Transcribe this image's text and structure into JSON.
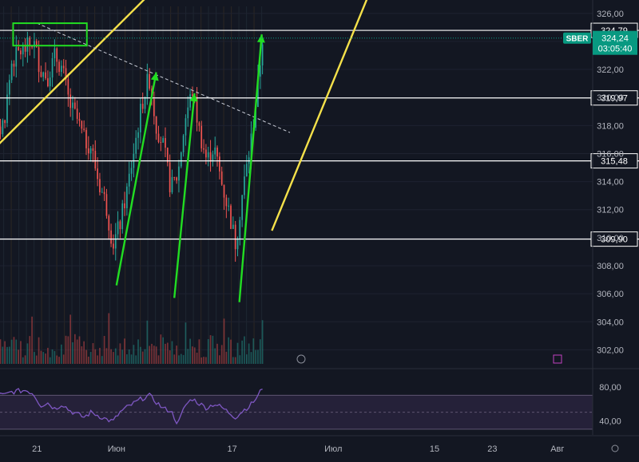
{
  "chart_data": [
    {
      "type": "candlestick",
      "symbol": "SBER",
      "y_axis": {
        "min": 301.0,
        "max": 326.5,
        "ticks": [
          "326,00",
          "324,00",
          "322,00",
          "320,00",
          "318,00",
          "316,00",
          "314,00",
          "312,00",
          "310,00",
          "308,00",
          "306,00",
          "304,00",
          "302,00"
        ],
        "tick_values": [
          326,
          324,
          322,
          320,
          318,
          316,
          314,
          312,
          310,
          308,
          306,
          304,
          302
        ]
      },
      "x_axis": {
        "ticks": [
          {
            "label": "21",
            "x": 21
          },
          {
            "label": "Июн",
            "x": 32
          },
          {
            "label": "17",
            "x": 48
          },
          {
            "label": "Июл",
            "x": 62
          },
          {
            "label": "15",
            "x": 76
          },
          {
            "label": "23",
            "x": 84
          },
          {
            "label": "Авг",
            "x": 93
          }
        ],
        "range": [
          15,
          97
        ]
      },
      "price_label": {
        "symbol": "SBER",
        "price": "324,24",
        "timer": "03:05:40",
        "value": 324.24
      },
      "horizontal_levels": [
        {
          "label": "324,79",
          "value": 324.79
        },
        {
          "label": "319,97",
          "value": 319.97
        },
        {
          "label": "315,48",
          "value": 315.48
        },
        {
          "label": "309,90",
          "value": 309.9
        }
      ],
      "trend_lines": [
        {
          "name": "yellow-line-1",
          "color": "#f5e14a",
          "dashed": false,
          "x": [
            15.0,
            41.5
          ],
          "y": [
            316.3,
            329.9
          ]
        },
        {
          "name": "yellow-line-2",
          "color": "#f5e14a",
          "dashed": false,
          "x": [
            53.5,
            69.5
          ],
          "y": [
            310.5,
            330.6
          ]
        },
        {
          "name": "dashed-resistance",
          "color": "#c8ccd6",
          "dashed": true,
          "x": [
            21.0,
            56.0
          ],
          "y": [
            325.3,
            317.5
          ]
        }
      ],
      "arrows": [
        {
          "name": "green-arrow-1",
          "color": "#22dd22",
          "x": [
            32.0,
            37.5
          ],
          "y": [
            306.6,
            321.8
          ]
        },
        {
          "name": "green-arrow-2",
          "color": "#22dd22",
          "x": [
            40.0,
            42.8
          ],
          "y": [
            305.7,
            320.3
          ]
        },
        {
          "name": "green-arrow-3",
          "color": "#22dd22",
          "x": [
            49.0,
            52.1
          ],
          "y": [
            305.4,
            324.5
          ]
        }
      ],
      "highlight_box": {
        "name": "top-highlight-box",
        "color": "#22dd22",
        "x": [
          17.7,
          27.9
        ],
        "y": [
          325.3,
          323.7
        ]
      },
      "candle_seed": {
        "x_start": 15.0,
        "x_end": 52.2,
        "count": 120
      },
      "candles_ohlc_path": [
        {
          "x": 15.0,
          "o": 315.0,
          "c": 316.5
        },
        {
          "x": 16.5,
          "o": 317.5,
          "c": 318.5
        },
        {
          "x": 17.5,
          "o": 319.5,
          "c": 322.5
        },
        {
          "x": 18.5,
          "o": 322.0,
          "c": 323.2
        },
        {
          "x": 19.5,
          "o": 323.0,
          "c": 323.5
        },
        {
          "x": 20.5,
          "o": 322.0,
          "c": 324.0
        },
        {
          "x": 21.5,
          "o": 321.5,
          "c": 322.0
        },
        {
          "x": 22.5,
          "o": 322.5,
          "c": 321.5
        },
        {
          "x": 23.5,
          "o": 322.0,
          "c": 323.0
        },
        {
          "x": 24.5,
          "o": 323.5,
          "c": 322.0
        },
        {
          "x": 25.5,
          "o": 321.5,
          "c": 319.5
        },
        {
          "x": 26.5,
          "o": 320.5,
          "c": 318.5
        },
        {
          "x": 27.5,
          "o": 318.0,
          "c": 317.0
        },
        {
          "x": 28.5,
          "o": 317.5,
          "c": 316.5
        },
        {
          "x": 29.5,
          "o": 316.5,
          "c": 314.0
        },
        {
          "x": 30.5,
          "o": 313.5,
          "c": 312.5
        },
        {
          "x": 31.5,
          "o": 311.0,
          "c": 309.5
        },
        {
          "x": 32.5,
          "o": 309.0,
          "c": 311.0
        },
        {
          "x": 33.5,
          "o": 311.5,
          "c": 313.5
        },
        {
          "x": 34.5,
          "o": 314.0,
          "c": 316.5
        },
        {
          "x": 35.5,
          "o": 316.0,
          "c": 319.5
        },
        {
          "x": 36.5,
          "o": 319.0,
          "c": 321.5
        },
        {
          "x": 37.5,
          "o": 320.0,
          "c": 318.0
        },
        {
          "x": 38.5,
          "o": 318.0,
          "c": 316.5
        },
        {
          "x": 39.5,
          "o": 316.0,
          "c": 313.5
        },
        {
          "x": 40.5,
          "o": 312.5,
          "c": 314.5
        },
        {
          "x": 41.5,
          "o": 316.0,
          "c": 318.5
        },
        {
          "x": 42.5,
          "o": 319.0,
          "c": 320.5
        },
        {
          "x": 43.5,
          "o": 319.5,
          "c": 317.5
        },
        {
          "x": 44.5,
          "o": 317.0,
          "c": 315.5
        },
        {
          "x": 45.5,
          "o": 315.0,
          "c": 316.5
        },
        {
          "x": 46.5,
          "o": 316.0,
          "c": 314.0
        },
        {
          "x": 47.5,
          "o": 313.5,
          "c": 312.0
        },
        {
          "x": 48.5,
          "o": 311.5,
          "c": 309.5
        },
        {
          "x": 49.5,
          "o": 310.5,
          "c": 313.5
        },
        {
          "x": 50.5,
          "o": 313.5,
          "c": 316.5
        },
        {
          "x": 51.5,
          "o": 317.0,
          "c": 320.5
        },
        {
          "x": 52.2,
          "o": 320.0,
          "c": 324.2
        }
      ],
      "rsi": {
        "levels": [
          "80,00",
          "40,00"
        ],
        "level_values": [
          80,
          40
        ],
        "range": [
          28,
          92
        ],
        "band": [
          70,
          30
        ],
        "path": [
          {
            "x": 15.0,
            "v": 72
          },
          {
            "x": 16.5,
            "v": 70
          },
          {
            "x": 17.5,
            "v": 74
          },
          {
            "x": 18.5,
            "v": 75
          },
          {
            "x": 19.5,
            "v": 76
          },
          {
            "x": 20.5,
            "v": 72
          },
          {
            "x": 21.5,
            "v": 58
          },
          {
            "x": 22.5,
            "v": 61
          },
          {
            "x": 23.5,
            "v": 54
          },
          {
            "x": 24.5,
            "v": 60
          },
          {
            "x": 25.5,
            "v": 52
          },
          {
            "x": 26.5,
            "v": 48
          },
          {
            "x": 27.5,
            "v": 44
          },
          {
            "x": 28.5,
            "v": 50
          },
          {
            "x": 29.5,
            "v": 46
          },
          {
            "x": 30.5,
            "v": 42
          },
          {
            "x": 31.5,
            "v": 39
          },
          {
            "x": 32.5,
            "v": 50
          },
          {
            "x": 33.5,
            "v": 56
          },
          {
            "x": 34.5,
            "v": 61
          },
          {
            "x": 35.5,
            "v": 66
          },
          {
            "x": 36.5,
            "v": 70
          },
          {
            "x": 37.5,
            "v": 62
          },
          {
            "x": 38.5,
            "v": 54
          },
          {
            "x": 39.5,
            "v": 52
          },
          {
            "x": 40.5,
            "v": 36
          },
          {
            "x": 41.5,
            "v": 58
          },
          {
            "x": 42.5,
            "v": 66
          },
          {
            "x": 43.5,
            "v": 60
          },
          {
            "x": 44.5,
            "v": 55
          },
          {
            "x": 45.5,
            "v": 60
          },
          {
            "x": 46.5,
            "v": 56
          },
          {
            "x": 47.5,
            "v": 50
          },
          {
            "x": 48.5,
            "v": 44
          },
          {
            "x": 49.5,
            "v": 52
          },
          {
            "x": 50.5,
            "v": 58
          },
          {
            "x": 51.5,
            "v": 68
          },
          {
            "x": 52.2,
            "v": 79
          }
        ]
      },
      "colors": {
        "background": "#131722",
        "up": "#26a69a",
        "down": "#ef5350",
        "rsi_line": "#7e57c2",
        "rsi_band": "#2a2440",
        "grid": "#1e2230",
        "axis_text": "#b2b5be",
        "level_line": "#ffffff",
        "price_tag": "#089981"
      }
    }
  ]
}
